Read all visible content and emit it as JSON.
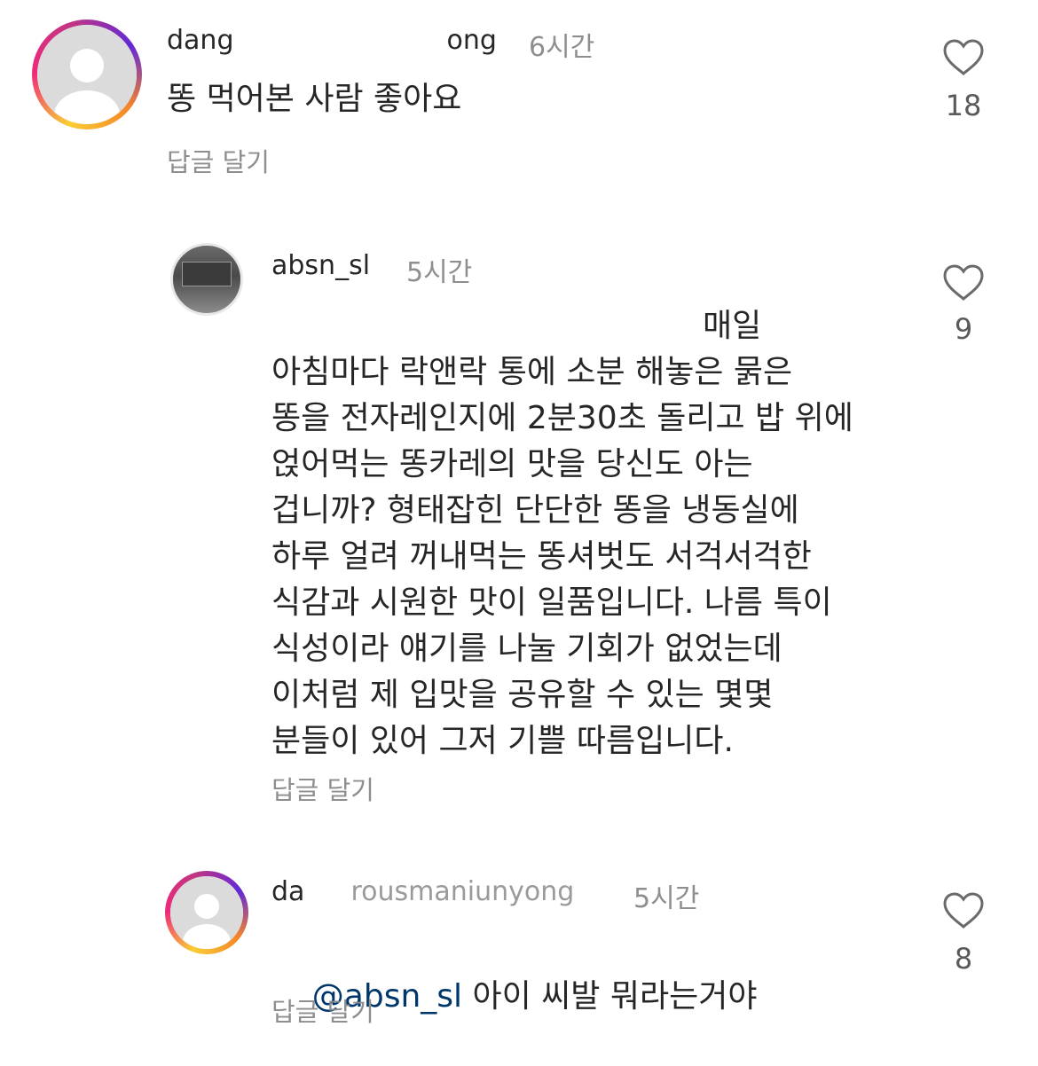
{
  "comments": [
    {
      "username_prefix": "dang",
      "username_suffix": "ong",
      "time": "6시간",
      "text": "똥 먹어본 사람 좋아요",
      "reply_label": "답글 달기",
      "likes": "18",
      "avatar_icon": "default-avatar-icon"
    },
    {
      "username": "absn_sl",
      "time": "5시간",
      "first_line_tail": "매일",
      "body_lines": [
        "아침마다 락앤락 통에 소분 해놓은 묽은",
        "똥을 전자레인지에 2분30초 돌리고 밥 위에",
        "얹어먹는 똥카레의 맛을 당신도 아는",
        "겁니까? 형태잡힌 단단한 똥을 냉동실에",
        "하루 얼려 꺼내먹는 똥셔벗도 서걱서걱한",
        "식감과 시원한 맛이 일품입니다. 나름 특이",
        "식성이라 얘기를 나눌 기회가 없었는데",
        "이처럼 제 입맛을 공유할 수 있는 몇몇",
        "분들이 있어 그저 기쁠 따름입니다."
      ],
      "reply_label": "답글 달기",
      "likes": "9",
      "avatar_icon": "profile-photo"
    },
    {
      "username_prefix": "da",
      "username_mid": "rousmaniunyong",
      "time": "5시간",
      "mention": "@absn_sl",
      "text": " 아이 씨발 뭐라는거야",
      "reply_label": "답글 달기",
      "likes": "8",
      "avatar_icon": "default-avatar-icon"
    }
  ],
  "icons": {
    "like": "heart-outline-icon"
  },
  "colors": {
    "text": "#262626",
    "secondary": "#8e8e8e",
    "mention": "#00376b"
  }
}
